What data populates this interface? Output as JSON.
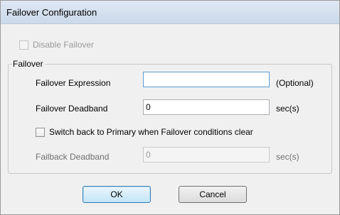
{
  "window": {
    "title": "Failover Configuration"
  },
  "disable_failover": {
    "label": "Disable Failover",
    "checked": false,
    "enabled": false
  },
  "group": {
    "legend": "Failover",
    "expression": {
      "label": "Failover Expression",
      "value": "",
      "suffix": "(Optional)"
    },
    "deadband": {
      "label": "Failover Deadband",
      "value": "0",
      "suffix": "sec(s)"
    },
    "switch_back": {
      "label": "Switch back to Primary when Failover conditions clear",
      "checked": false
    },
    "failback": {
      "label": "Failback Deadband",
      "value": "0",
      "suffix": "sec(s)",
      "enabled": false
    }
  },
  "buttons": {
    "ok": "OK",
    "cancel": "Cancel"
  }
}
